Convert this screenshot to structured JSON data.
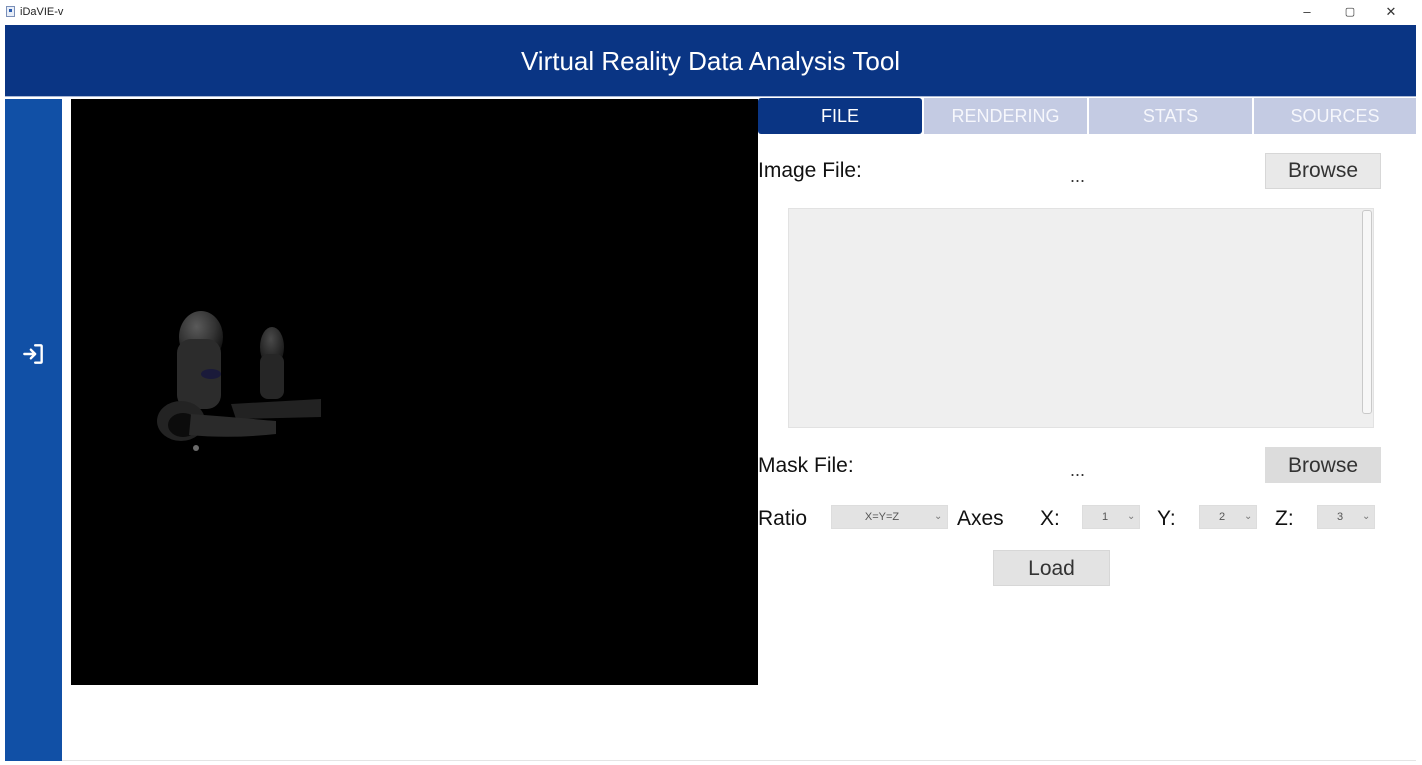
{
  "window": {
    "app_name": "iDaVIE-v",
    "minimize": "–",
    "maximize": "▢",
    "close": "✕"
  },
  "header": {
    "title": "Virtual Reality Data Analysis Tool"
  },
  "sidebar": {
    "exit_icon": "exit-to-right-icon"
  },
  "tabs": [
    {
      "label": "FILE",
      "active": true
    },
    {
      "label": "RENDERING",
      "active": false
    },
    {
      "label": "STATS",
      "active": false
    },
    {
      "label": "SOURCES",
      "active": false
    }
  ],
  "file_panel": {
    "image_file_label": "Image File:",
    "image_file_value": "...",
    "browse_label": "Browse",
    "mask_file_label": "Mask File:",
    "mask_file_value": "...",
    "mask_browse_label": "Browse",
    "ratio_label": "Ratio",
    "ratio_value": "X=Y=Z",
    "axes_label": "Axes",
    "x_label": "X:",
    "x_value": "1",
    "y_label": "Y:",
    "y_value": "2",
    "z_label": "Z:",
    "z_value": "3",
    "load_label": "Load"
  },
  "colors": {
    "header": "#0a3584",
    "sidebar": "#1150a6",
    "tab_active": "#0a3584",
    "tab_inactive": "#c4cbe3"
  }
}
